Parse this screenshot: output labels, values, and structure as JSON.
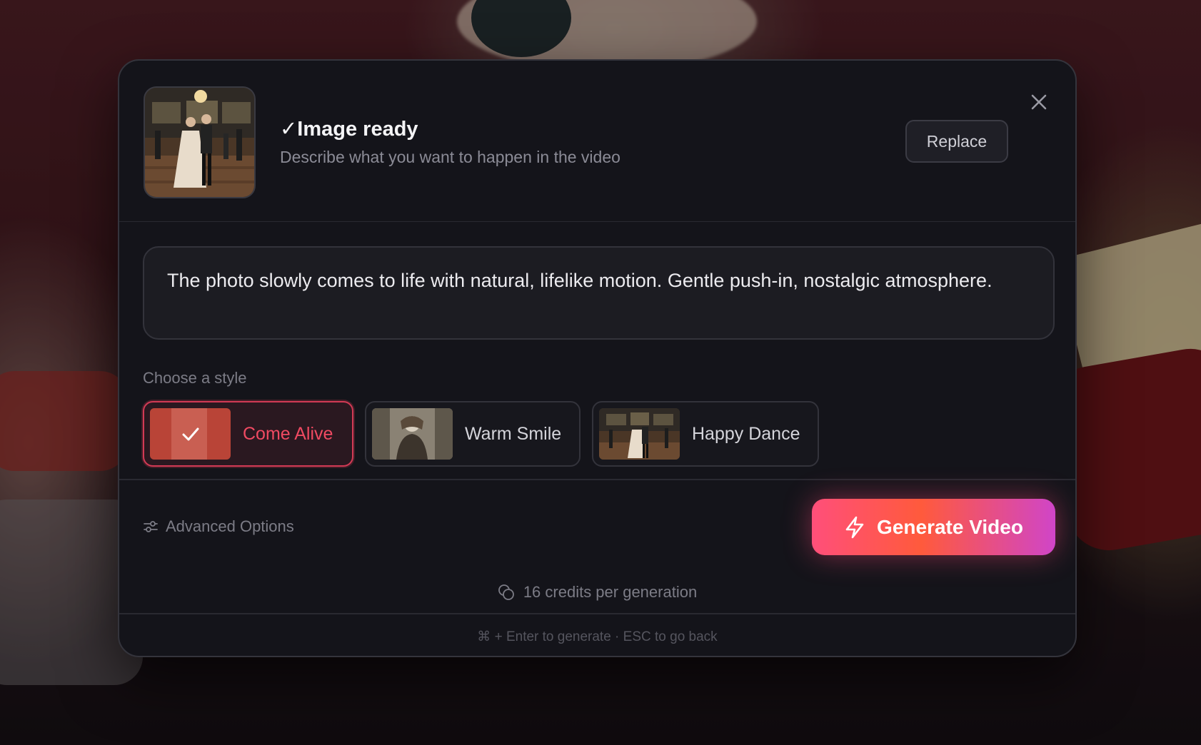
{
  "header": {
    "title": "✓Image ready",
    "subtitle": "Describe what you want to happen in the video",
    "replace_label": "Replace",
    "close_icon": "close-icon"
  },
  "prompt": {
    "text": "The photo slowly comes to life with natural, lifelike motion. Gentle push-in, nostalgic atmosphere."
  },
  "styles": {
    "label": "Choose a style",
    "items": [
      {
        "name": "Come Alive",
        "selected": true
      },
      {
        "name": "Warm Smile",
        "selected": false
      },
      {
        "name": "Happy Dance",
        "selected": false
      }
    ]
  },
  "footer": {
    "advanced_label": "Advanced Options",
    "advanced_icon": "sliders-icon",
    "generate_label": "Generate Video",
    "generate_icon": "lightning-icon",
    "credits_text": "16 credits per generation",
    "credits_icon": "coins-icon",
    "hint": "⌘ + Enter to generate · ESC to go back"
  },
  "colors": {
    "accent": "#f04a62",
    "modal_bg": "#14141a",
    "gradient_start": "#ff4f7a",
    "gradient_mid": "#ff5a3c",
    "gradient_end": "#d045c8"
  }
}
